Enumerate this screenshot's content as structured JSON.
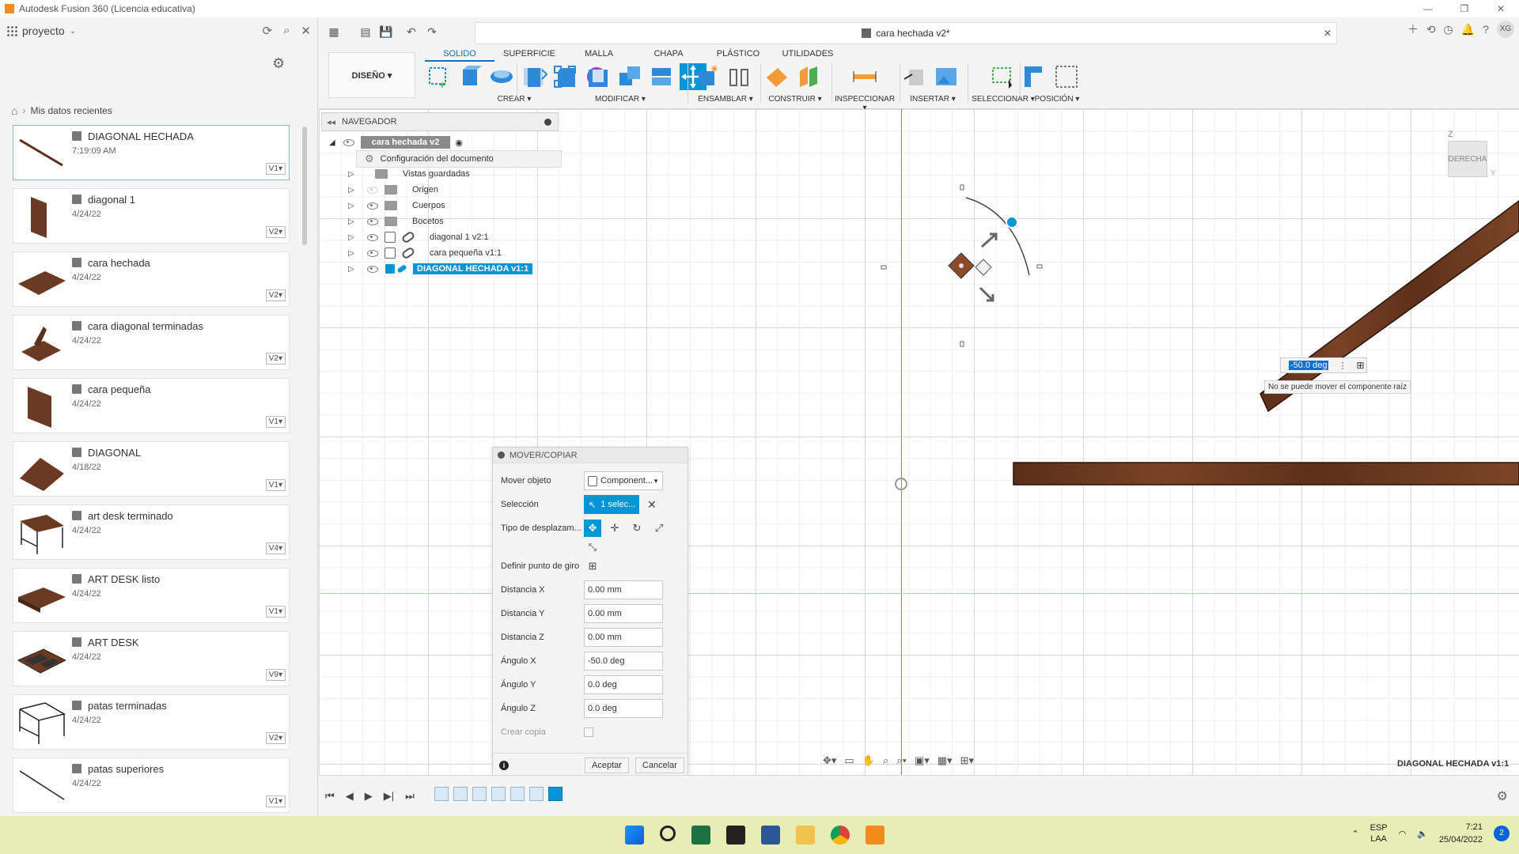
{
  "window": {
    "title": "Autodesk Fusion 360 (Licencia educativa)",
    "controls": [
      "—",
      "❐",
      "✕"
    ]
  },
  "data_panel": {
    "project": "proyecto",
    "breadcrumb": "Mis datos recientes",
    "items": [
      {
        "name": "DIAGONAL HECHADA",
        "date": "7:19:09 AM",
        "version": "V1▾"
      },
      {
        "name": "diagonal 1",
        "date": "4/24/22",
        "version": "V2▾"
      },
      {
        "name": "cara hechada",
        "date": "4/24/22",
        "version": "V2▾"
      },
      {
        "name": "cara diagonal terminadas",
        "date": "4/24/22",
        "version": "V2▾"
      },
      {
        "name": "cara pequeña",
        "date": "4/24/22",
        "version": "V1▾"
      },
      {
        "name": "DIAGONAL",
        "date": "4/18/22",
        "version": "V1▾"
      },
      {
        "name": "art desk terminado",
        "date": "4/24/22",
        "version": "V4▾"
      },
      {
        "name": "ART DESK listo",
        "date": "4/24/22",
        "version": "V1▾"
      },
      {
        "name": "ART DESK",
        "date": "4/24/22",
        "version": "V9▾"
      },
      {
        "name": "patas terminadas",
        "date": "4/24/22",
        "version": "V2▾"
      },
      {
        "name": "patas superiores",
        "date": "4/24/22",
        "version": "V1▾"
      }
    ]
  },
  "document": {
    "tab_title": "cara hechada v2*"
  },
  "ribbon": {
    "workspace": "DISEÑO ▾",
    "tabs": [
      "SOLIDO",
      "SUPERFICIE",
      "MALLA",
      "CHAPA",
      "PLÁSTICO",
      "UTILIDADES"
    ],
    "groups": [
      "CREAR ▾",
      "MODIFICAR ▾",
      "ENSAMBLAR ▾",
      "CONSTRUIR ▾",
      "INSPECCIONAR ▾",
      "INSERTAR ▾",
      "SELECCIONAR ▾",
      "POSICIÓN ▾"
    ]
  },
  "navigator": {
    "title": "NAVEGADOR",
    "root": "cara hechada v2",
    "config": "Configuración del documento",
    "rows": [
      "Vistas guardadas",
      "Origen",
      "Cuerpos",
      "Bocetos",
      "diagonal 1 v2:1",
      "cara pequeña v1:1",
      "DIAGONAL HECHADA v1:1"
    ]
  },
  "dialog": {
    "title": "MOVER/COPIAR",
    "move_object_label": "Mover objeto",
    "move_object_value": "Component...",
    "selection_label": "Selección",
    "selection_value": "1 selec...",
    "move_type_label": "Tipo de desplazam...",
    "pivot_label": "Definir punto de giro",
    "dist_x_label": "Distancia X",
    "dist_x": "0.00 mm",
    "dist_y_label": "Distancia Y",
    "dist_y": "0.00 mm",
    "dist_z_label": "Distancia Z",
    "dist_z": "0.00 mm",
    "ang_x_label": "Ángulo X",
    "ang_x": "-50.0 deg",
    "ang_y_label": "Ángulo Y",
    "ang_y": "0.0 deg",
    "ang_z_label": "Ángulo Z",
    "ang_z": "0.0 deg",
    "copy_label": "Crear copia",
    "ok": "Aceptar",
    "cancel": "Cancelar"
  },
  "viewport": {
    "viewcube_face": "DERECHA",
    "axis_z": "Z",
    "axis_y": "Y",
    "angle_value": "-50.0 deg",
    "tooltip": "No se puede mover el componente raíz",
    "selected_name": "DIAGONAL HECHADA v1:1"
  },
  "taskbar": {
    "lang1": "ESP",
    "lang2": "LAA",
    "time": "7:21",
    "date": "25/04/2022",
    "notifications": "2"
  },
  "colors": {
    "accent": "#0696d7",
    "wood": "#6b3a22",
    "taskbar": "#e8edb5"
  }
}
